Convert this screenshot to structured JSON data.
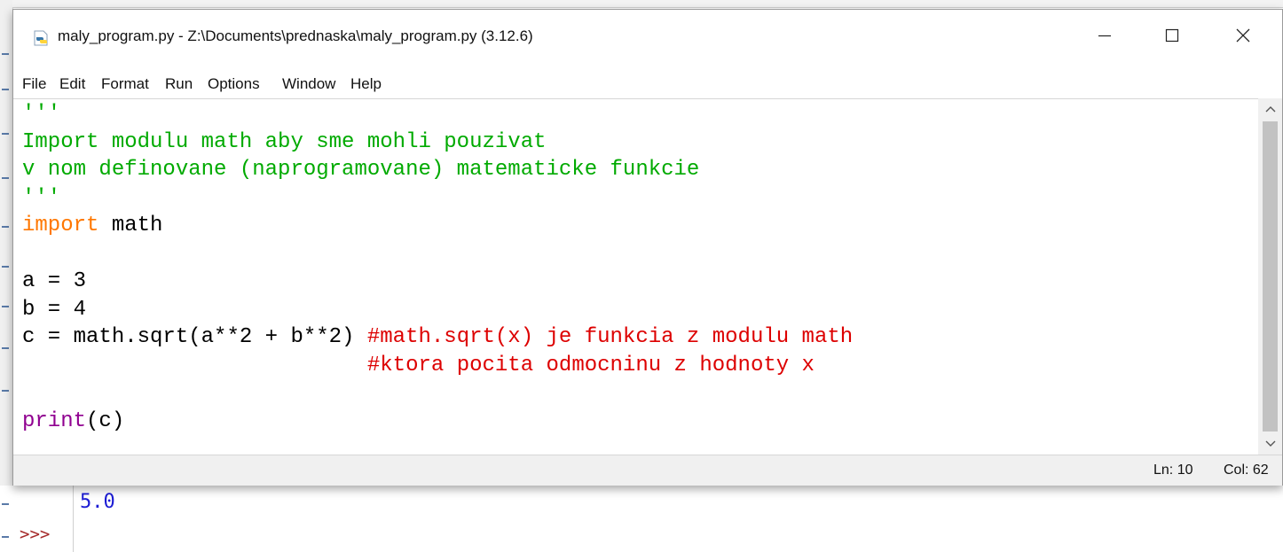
{
  "window": {
    "title": "maly_program.py - Z:\\Documents\\prednaska\\maly_program.py (3.12.6)",
    "icon": "python-file-icon"
  },
  "menu": [
    "File",
    "Edit",
    "Format",
    "Run",
    "Options",
    "Window",
    "Help"
  ],
  "editor": {
    "lines": [
      [
        {
          "t": "'''",
          "k": "string"
        }
      ],
      [
        {
          "t": "Import modulu math aby sme mohli pouzivat",
          "k": "string"
        }
      ],
      [
        {
          "t": "v nom definovane (naprogramovane) matematicke funkcie",
          "k": "string"
        }
      ],
      [
        {
          "t": "'''",
          "k": "string"
        }
      ],
      [
        {
          "t": "import",
          "k": "keyword"
        },
        {
          "t": " math",
          "k": "default"
        }
      ],
      [],
      [
        {
          "t": "a = 3",
          "k": "default"
        }
      ],
      [
        {
          "t": "b = 4",
          "k": "default"
        }
      ],
      [
        {
          "t": "c = math.sqrt(a**2 + b**2) ",
          "k": "default"
        },
        {
          "t": "#math.sqrt(x) je funkcia z modulu math",
          "k": "comment"
        }
      ],
      [
        {
          "t": "                           ",
          "k": "default"
        },
        {
          "t": "#ktora pocita odmocninu z hodnoty x",
          "k": "comment"
        }
      ],
      [],
      [
        {
          "t": "print",
          "k": "builtin"
        },
        {
          "t": "(c)",
          "k": "default"
        }
      ]
    ]
  },
  "status": {
    "line": "Ln: 10",
    "col": "Col: 62"
  },
  "shell": {
    "output": "5.0",
    "prompt": ">>>"
  },
  "colors": {
    "string": "#00aa00",
    "keyword": "#ff7700",
    "builtin": "#900090",
    "comment": "#dd0000",
    "default": "#000000",
    "shell_output": "#1c1cd4",
    "shell_prompt": "#a52a2a"
  }
}
